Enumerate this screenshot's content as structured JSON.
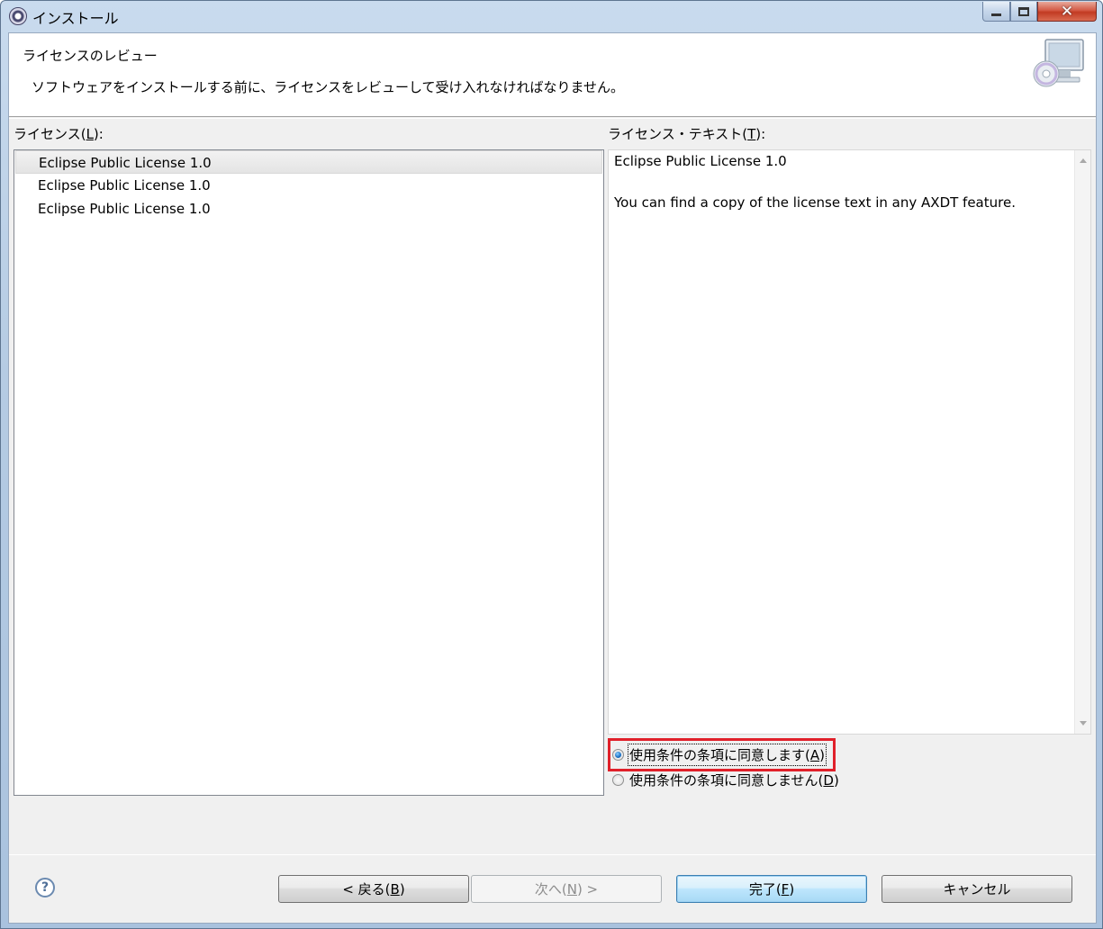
{
  "window": {
    "title": "インストール",
    "icon": "eclipse-icon"
  },
  "banner": {
    "title": "ライセンスのレビュー",
    "message": "ソフトウェアをインストールする前に、ライセンスをレビューして受け入れなければなりません。",
    "icon": "install-computer-cd-icon"
  },
  "licenses": {
    "label": "ライセンス(",
    "mnemonic": "L",
    "label_suffix": "):",
    "items": [
      {
        "label": "Eclipse Public License 1.0",
        "selected": true
      },
      {
        "label": "Eclipse Public License 1.0",
        "selected": false
      },
      {
        "label": "Eclipse Public License 1.0",
        "selected": false
      }
    ]
  },
  "license_text": {
    "label": "ライセンス・テキスト(",
    "mnemonic": "T",
    "label_suffix": "):",
    "line1": "Eclipse Public License 1.0",
    "line2": "You can find a copy of the license text in any AXDT feature."
  },
  "agreement": {
    "accept_label": "使用条件の条項に同意します(",
    "accept_mnemonic": "A",
    "decline_label": "使用条件の条項に同意しません(",
    "decline_mnemonic": "D",
    "suffix": ")",
    "selected": "accept",
    "highlight_color": "#e0202a"
  },
  "buttons": {
    "back_prefix": "< 戻る(",
    "back_mnemonic": "B",
    "back_suffix": ")",
    "next_prefix": "次へ(",
    "next_mnemonic": "N",
    "next_suffix": ") >",
    "finish_prefix": "完了(",
    "finish_mnemonic": "F",
    "finish_suffix": ")",
    "cancel": "キャンセル",
    "help": "?"
  }
}
